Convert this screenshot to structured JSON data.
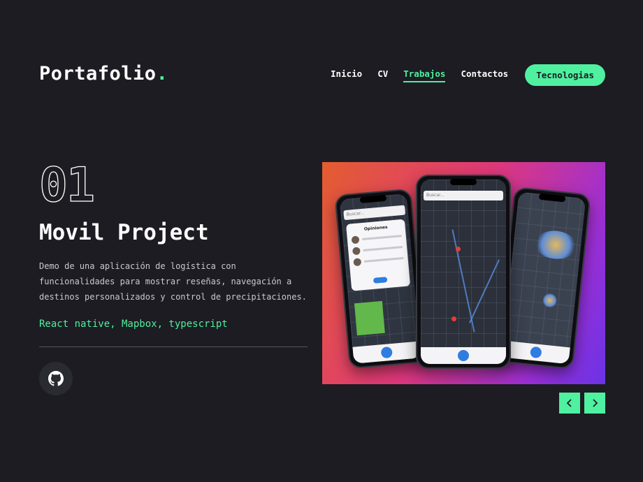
{
  "header": {
    "logo_text": "Portafolio",
    "logo_dot": ".",
    "nav": [
      {
        "label": "Inicio"
      },
      {
        "label": "CV"
      },
      {
        "label": "Trabajos",
        "active": true
      },
      {
        "label": "Contactos"
      }
    ],
    "cta_label": "Tecnologias"
  },
  "project": {
    "number": "01",
    "title": "Movil Project",
    "description": "Demo de una aplicación de logística con funcionalidades para mostrar reseñas, navegación a destinos personalizados y control de precipitaciones.",
    "stack": "React native, Mapbox, typescript"
  },
  "mockup": {
    "search_placeholder": "Buscar...",
    "card_title": "Opiniones"
  },
  "icons": {
    "github": "github-icon",
    "prev": "chevron-left-icon",
    "next": "chevron-right-icon"
  },
  "colors": {
    "background": "#1c1c22",
    "accent": "#4ff0a0",
    "text": "#ffffff",
    "muted": "#c9c9cf"
  }
}
